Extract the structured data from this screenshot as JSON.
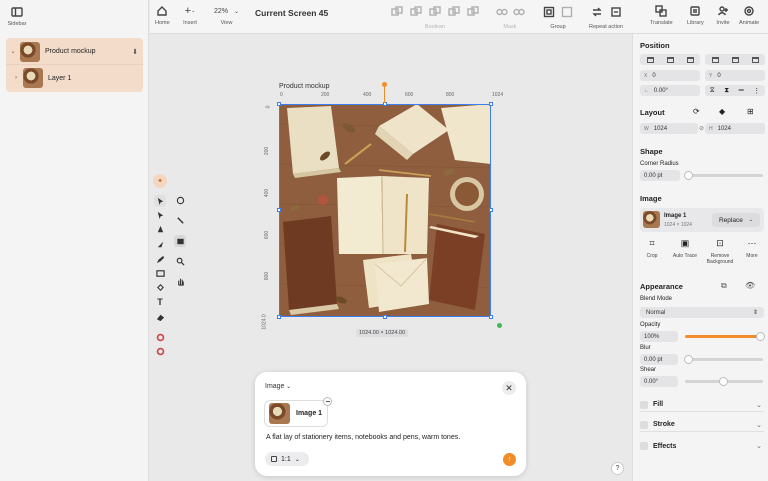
{
  "sidebar": {
    "toggle_label": "Sidebar",
    "layers": [
      {
        "name": "Product mockup",
        "expanded": true
      },
      {
        "name": "Layer 1",
        "expanded": false
      }
    ]
  },
  "toolbar": {
    "home": "Home",
    "insert": "Insert",
    "zoom_value": "22%",
    "view": "View",
    "document_title": "Current Screen 45",
    "boolean": "Boolean",
    "mask": "Mask",
    "group": "Group",
    "repeat_action": "Repeat action",
    "translate": "Translate",
    "library": "Library",
    "invite": "Invite",
    "animate": "Animate"
  },
  "canvas": {
    "frame_label": "Product mockup",
    "ruler_top": [
      "0",
      "200",
      "400",
      "600",
      "800",
      "1024"
    ],
    "ruler_left": [
      "0",
      "200",
      "400",
      "600",
      "800",
      "1024.0"
    ],
    "size_badge": "1024.00 × 1024.00"
  },
  "prompt": {
    "dropdown_label": "Image",
    "attachment_name": "Image 1",
    "text": "A flat lay of stationery items, notebooks and pens, warm tones.",
    "aspect_ratio": "1:1",
    "send_color": "#f28c28"
  },
  "panel": {
    "position": {
      "title": "Position",
      "x_label": "X",
      "x_value": "0",
      "y_label": "Y",
      "y_value": "0",
      "rotation_value": "0.00°"
    },
    "layout": {
      "title": "Layout",
      "w_label": "W",
      "w_value": "1024",
      "h_label": "H",
      "h_value": "1024"
    },
    "shape": {
      "title": "Shape",
      "corner_radius_label": "Corner Radius",
      "corner_radius_value": "0.00 pt"
    },
    "image": {
      "title": "Image",
      "name": "Image 1",
      "dimensions": "1024 × 1024",
      "replace_label": "Replace",
      "actions": [
        "Crop",
        "Auto Trace",
        "Remove Background",
        "More"
      ]
    },
    "appearance": {
      "title": "Appearance",
      "blend_mode_label": "Blend Mode",
      "blend_mode_value": "Normal",
      "opacity_label": "Opacity",
      "opacity_value": "100%",
      "opacity_level": 1.0,
      "blur_label": "Blur",
      "blur_value": "0.00 pt",
      "shear_label": "Shear",
      "shear_value": "0.00°"
    },
    "fill_label": "Fill",
    "stroke_label": "Stroke",
    "effects_label": "Effects"
  },
  "colors": {
    "accent": "#f28c28",
    "selection": "#3d7df2",
    "layer_highlight": "#f4dccb"
  },
  "help_label": "?"
}
